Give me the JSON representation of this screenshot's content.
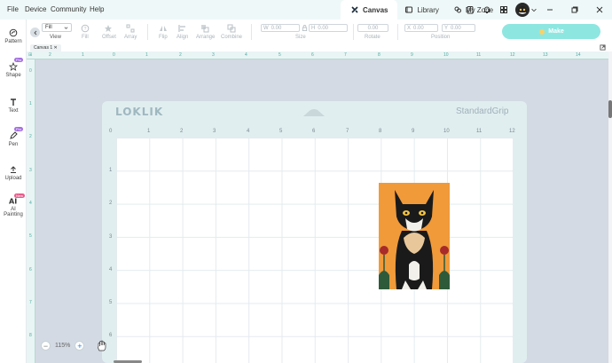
{
  "menu": [
    "File",
    "Device",
    "Community",
    "Help"
  ],
  "tabs": [
    {
      "label": "Canvas",
      "icon": "canvas-icon",
      "active": true
    },
    {
      "label": "Library",
      "icon": "library-icon",
      "active": false
    },
    {
      "label": "My Zone",
      "icon": "my-zone-icon",
      "active": false
    }
  ],
  "toolbar": {
    "fill_value": "Fill",
    "view_label": "View",
    "tools": [
      "Fill",
      "Offset",
      "Array",
      "Flip",
      "Align",
      "Arrange",
      "Combine"
    ],
    "w_label": "W",
    "w_value": "0.00",
    "h_label": "H",
    "h_value": "0.00",
    "size_label": "Size",
    "rotate_value": "0.00",
    "rotate_label": "Rotate",
    "x_label": "X",
    "x_value": "0.00",
    "y_label": "Y",
    "y_value": "0.00",
    "position_label": "Position",
    "make_label": "Make"
  },
  "sidebar": [
    {
      "label": "Pattern",
      "icon": "pattern-icon"
    },
    {
      "label": "Shape",
      "icon": "shape-icon",
      "badge": "Pro"
    },
    {
      "label": "Text",
      "icon": "text-icon"
    },
    {
      "label": "Pen",
      "icon": "pen-icon",
      "badge": "Pro"
    },
    {
      "label": "Upload",
      "icon": "upload-icon"
    },
    {
      "label": "AI Painting",
      "label_line1": "AI",
      "label_line2": "Painting",
      "icon": "ai-painting-icon",
      "badge": "New"
    }
  ],
  "canvas_tab": {
    "label": "Canvas 1"
  },
  "ruler_h": [
    "2",
    "1",
    "0",
    "1",
    "2",
    "3",
    "4",
    "5",
    "6",
    "7",
    "8",
    "9",
    "10",
    "11",
    "12",
    "13",
    "14"
  ],
  "ruler_v": [
    "0",
    "1",
    "2",
    "3",
    "4",
    "5",
    "6",
    "7",
    "8"
  ],
  "mat": {
    "logo": "LOKLIK",
    "grip": "StandardGrip",
    "x_numbers": [
      "0",
      "1",
      "2",
      "3",
      "4",
      "5",
      "6",
      "7",
      "8",
      "9",
      "10",
      "11",
      "12"
    ],
    "y_numbers": [
      "1",
      "2",
      "3",
      "4",
      "5",
      "6"
    ]
  },
  "zoom": {
    "value": "115%"
  },
  "colors": {
    "accent": "#8ee6e1",
    "ruler": "#4fa9a3",
    "workspace": "#d3dae3",
    "mat": "#e1eef0",
    "image_bg": "#f09a3a"
  }
}
